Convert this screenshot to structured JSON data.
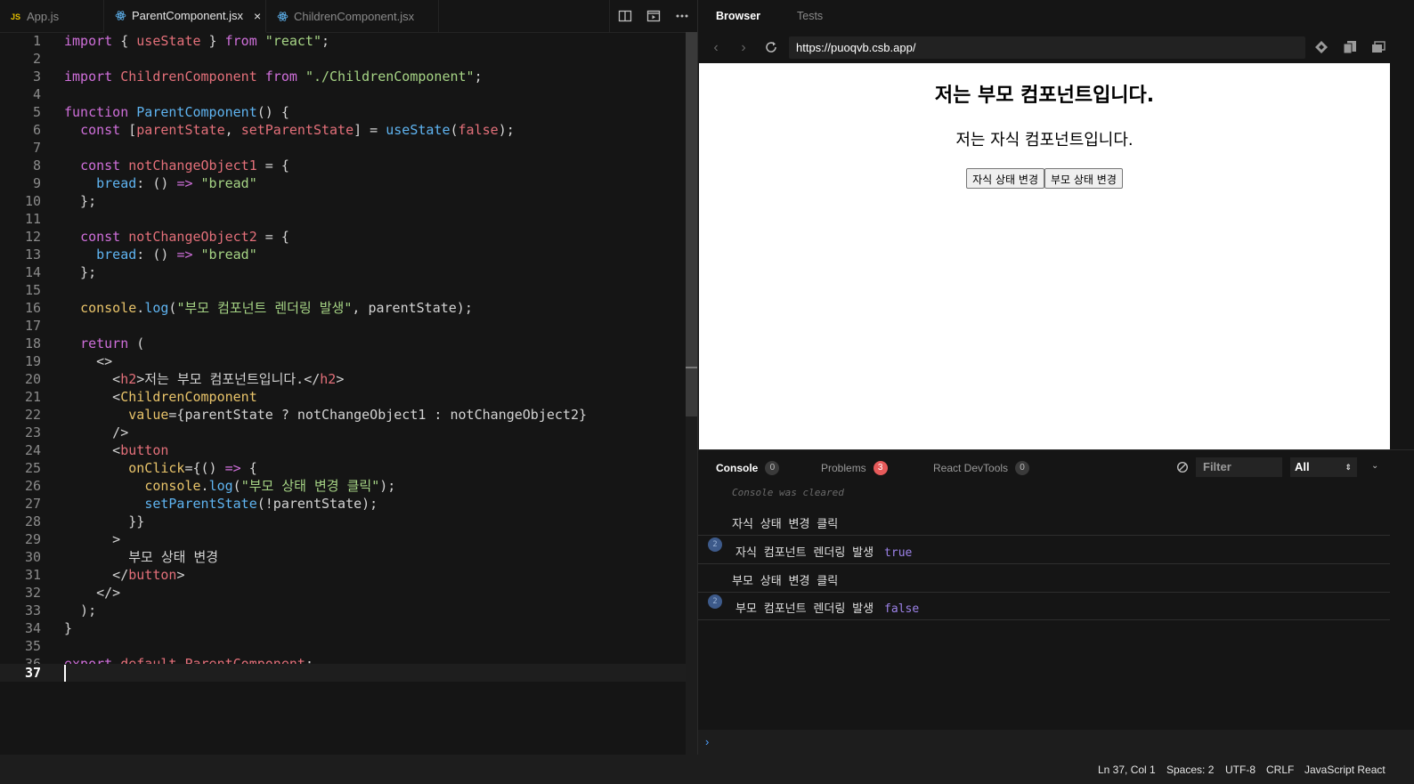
{
  "editor": {
    "tabs": [
      {
        "label": "App.js",
        "badge": "JS"
      },
      {
        "label": "ParentComponent.jsx",
        "close": "×"
      },
      {
        "label": "ChildrenComponent.jsx"
      }
    ],
    "current_line": 37
  },
  "browser": {
    "tabs": {
      "browser": "Browser",
      "tests": "Tests"
    },
    "url": "https://puoqvb.csb.app/",
    "page": {
      "heading": "저는 부모 컴포넌트입니다.",
      "subheading": "저는 자식 컴포넌트입니다.",
      "child_button": "자식 상태 변경",
      "parent_button": "부모 상태 변경"
    }
  },
  "console": {
    "tabs": {
      "console": "Console",
      "console_count": "0",
      "problems": "Problems",
      "problems_count": "3",
      "devtools": "React DevTools",
      "devtools_count": "0"
    },
    "filter_placeholder": "Filter",
    "level": "All",
    "cleared_text": "Console was cleared",
    "entries": [
      {
        "text": "자식 상태 변경 클릭"
      },
      {
        "count": "2",
        "text": "자식 컴포넌트 렌더링 발생",
        "value": "true"
      },
      {
        "text": "부모 상태 변경 클릭"
      },
      {
        "count": "2",
        "text": "부모 컴포넌트 렌더링 발생",
        "value": "false"
      }
    ],
    "prompt": "›"
  },
  "statusbar": {
    "position": "Ln 37, Col 1",
    "spaces": "Spaces: 2",
    "encoding": "UTF-8",
    "eol": "CRLF",
    "language": "JavaScript React"
  },
  "colors": {
    "keyword": "#cf6fda",
    "string": "#a6d485",
    "function": "#5fb4f1",
    "variable": "#e4707a",
    "problems_badge": "#e65a5a",
    "console_value": "#9c82e8"
  }
}
